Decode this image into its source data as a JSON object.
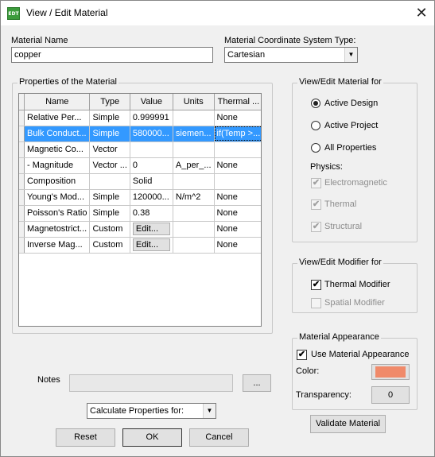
{
  "window": {
    "title": "View / Edit Material",
    "icon_text": "EDT",
    "close_glyph": "✕"
  },
  "material_name": {
    "label": "Material Name",
    "value": "copper"
  },
  "coord_system": {
    "label": "Material Coordinate System Type:",
    "value": "Cartesian"
  },
  "properties": {
    "group_title": "Properties of the Material",
    "columns": [
      "Name",
      "Type",
      "Value",
      "Units",
      "Thermal ..."
    ],
    "rows": [
      {
        "name": "Relative Per...",
        "type": "Simple",
        "value": "0.999991",
        "units": "",
        "thermal": "None",
        "selected": false,
        "value_is_button": false
      },
      {
        "name": "Bulk Conduct...",
        "type": "Simple",
        "value": "580000...",
        "units": "siemen...",
        "thermal": "if(Temp >...",
        "selected": true,
        "value_is_button": false
      },
      {
        "name": "Magnetic Co...",
        "type": "Vector",
        "value": "",
        "units": "",
        "thermal": "",
        "selected": false,
        "value_is_button": false
      },
      {
        "name": "- Magnitude",
        "type": "Vector ...",
        "value": "0",
        "units": "A_per_...",
        "thermal": "None",
        "selected": false,
        "value_is_button": false
      },
      {
        "name": "Composition",
        "type": "",
        "value": "Solid",
        "units": "",
        "thermal": "",
        "selected": false,
        "value_is_button": false
      },
      {
        "name": "Young's Mod...",
        "type": "Simple",
        "value": "120000...",
        "units": "N/m^2",
        "thermal": "None",
        "selected": false,
        "value_is_button": false
      },
      {
        "name": "Poisson's Ratio",
        "type": "Simple",
        "value": "0.38",
        "units": "",
        "thermal": "None",
        "selected": false,
        "value_is_button": false
      },
      {
        "name": "Magnetostrict...",
        "type": "Custom",
        "value": "Edit...",
        "units": "",
        "thermal": "None",
        "selected": false,
        "value_is_button": true
      },
      {
        "name": "Inverse Mag...",
        "type": "Custom",
        "value": "Edit...",
        "units": "",
        "thermal": "None",
        "selected": false,
        "value_is_button": true
      }
    ]
  },
  "view_edit_for": {
    "title": "View/Edit Material for",
    "options": [
      {
        "label": "Active Design",
        "selected": true
      },
      {
        "label": "Active Project",
        "selected": false
      },
      {
        "label": "All Properties",
        "selected": false
      }
    ],
    "physics_label": "Physics:",
    "physics": [
      {
        "label": "Electromagnetic",
        "checked": true
      },
      {
        "label": "Thermal",
        "checked": true
      },
      {
        "label": "Structural",
        "checked": true
      }
    ]
  },
  "modifier_for": {
    "title": "View/Edit Modifier for",
    "thermal": {
      "label": "Thermal Modifier",
      "checked": true
    },
    "spatial": {
      "label": "Spatial Modifier",
      "checked": false
    }
  },
  "appearance": {
    "title": "Material Appearance",
    "use_label": "Use Material Appearance",
    "use_checked": true,
    "color_label": "Color:",
    "color": "#f08a6a",
    "transparency_label": "Transparency:",
    "transparency_value": "0"
  },
  "notes": {
    "label": "Notes",
    "value": "",
    "browse_label": "..."
  },
  "calculate": {
    "value": "Calculate Properties for:"
  },
  "buttons": {
    "validate": "Validate Material",
    "reset": "Reset",
    "ok": "OK",
    "cancel": "Cancel"
  },
  "check_glyph": "✔"
}
